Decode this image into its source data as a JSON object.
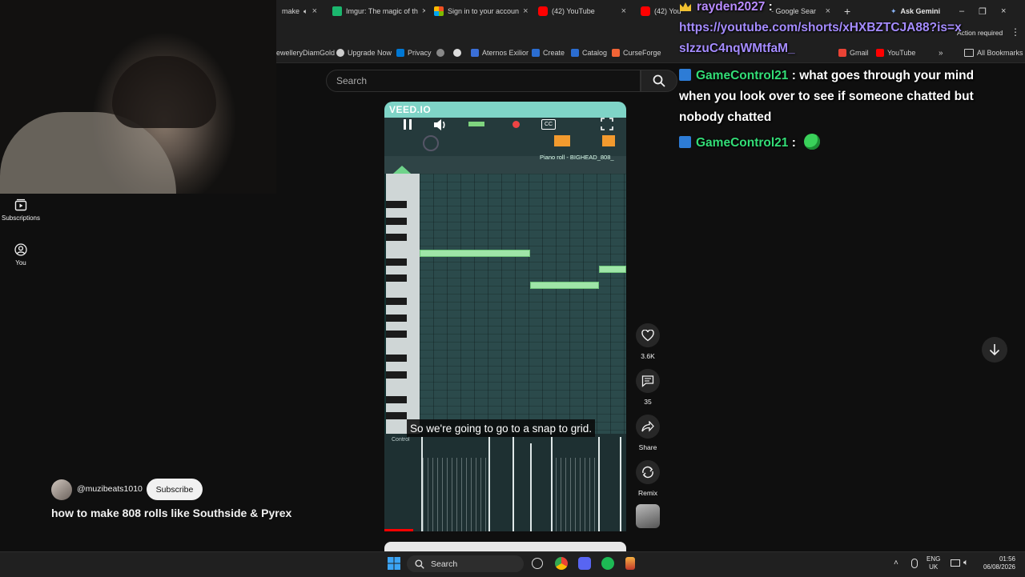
{
  "browser": {
    "tabs": [
      {
        "label": "make",
        "color": "#888888"
      },
      {
        "label": "Imgur: The magic of th",
        "color": "#1bb76e"
      },
      {
        "label": "Sign in to your accoun",
        "color": "#f25022"
      },
      {
        "label": "(42) YouTube",
        "color": "#ff0000"
      },
      {
        "label": "(42) YouTu",
        "color": "#ff0000"
      },
      {
        "label": "- Google Sear",
        "color": "#4285f4"
      }
    ],
    "new_tab": "+",
    "ask_gemini": "Ask Gemini",
    "action_required": "Action required",
    "bookmarks": [
      {
        "label": "ewelleryDiamGold",
        "color": "#9c7a4a"
      },
      {
        "label": "Upgrade Now",
        "color": "#cccccc"
      },
      {
        "label": "Privacy",
        "color": "#0078d4"
      },
      {
        "label": "",
        "color": "#888888"
      },
      {
        "label": "",
        "color": "#dddddd"
      },
      {
        "label": "Aternos Exilior",
        "color": "#3a6fd8"
      },
      {
        "label": "Create",
        "color": "#2b6dd1"
      },
      {
        "label": "Catalog",
        "color": "#2b6dd1"
      },
      {
        "label": "CurseForge",
        "color": "#f16436"
      },
      {
        "label": "Gmail",
        "color": "#ea4335"
      },
      {
        "label": "YouTube",
        "color": "#ff0000"
      }
    ],
    "all_bookmarks": "All Bookmarks"
  },
  "youtube": {
    "search_placeholder": "Search",
    "nav": [
      {
        "label": "Subscriptions",
        "icon": "subscriptions-icon"
      },
      {
        "label": "You",
        "icon": "you-icon"
      }
    ],
    "video": {
      "watermark": "VEED.IO",
      "piano_roll_label": "Piano roll - BIGHEAD_808_",
      "control_label": "Control",
      "caption": "So we're going to go to a snap to grid.",
      "progress": 0.12
    },
    "actions": {
      "likes": "3.6K",
      "comments": "35",
      "share": "Share",
      "remix": "Remix"
    },
    "channel": {
      "handle": "@muzibeats1010",
      "subscribe": "Subscribe"
    },
    "title": "how to make 808 rolls like Southside & Pyrex"
  },
  "chat": [
    {
      "user": "rayden2027",
      "sep": " :",
      "message": "",
      "link": "https://youtube.com/shorts/xHXBZTCJA88?is=xsIzzuC4nqWMtfaM_",
      "color": "#b98cff",
      "badge": "crown"
    },
    {
      "user": "GameControl21",
      "sep": " :",
      "message": "what goes through your mind when you look over to see if someone chatted but nobody chatted",
      "color": "#33dd77",
      "badge": "blue"
    },
    {
      "user": "GameControl21",
      "sep": " :",
      "message": "",
      "emote": "green-emote",
      "color": "#33dd77",
      "badge": "blue"
    }
  ],
  "taskbar": {
    "search": "Search",
    "lang_top": "ENG",
    "lang_bottom": "UK",
    "time": "01:56",
    "date": "06/08/2026"
  }
}
